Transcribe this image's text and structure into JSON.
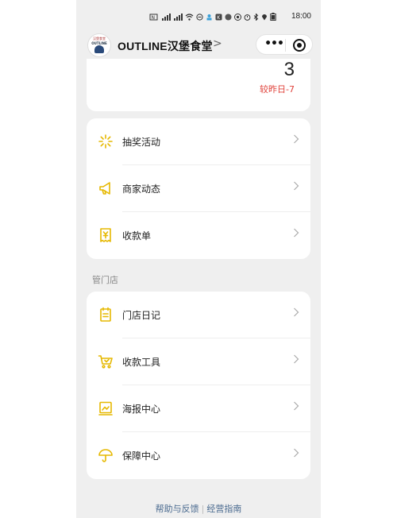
{
  "status_bar": {
    "time": "18:00",
    "left_icons": [
      "nfc-icon",
      "signal-icon",
      "signal-icon",
      "wifi-icon",
      "do-not-disturb-icon"
    ],
    "right_icons": [
      "app-icon",
      "app-icon",
      "app-icon",
      "app-icon",
      "alarm-icon",
      "bluetooth-icon",
      "location-icon",
      "battery-icon"
    ]
  },
  "header": {
    "logo_top_text": "汉堡食堂",
    "logo_mid_text": "OUTLINE",
    "title": "OUTLINE汉堡食堂",
    "chevron": ">"
  },
  "capsule": {
    "more": "•••"
  },
  "stat": {
    "value": "3",
    "compare": "较昨日-7"
  },
  "menu_group_1": [
    {
      "label": "抽奖活动",
      "icon": "lottery-icon"
    },
    {
      "label": "商家动态",
      "icon": "megaphone-icon"
    },
    {
      "label": "收款单",
      "icon": "receipt-icon"
    }
  ],
  "section_title": "管门店",
  "menu_group_2": [
    {
      "label": "门店日记",
      "icon": "diary-icon"
    },
    {
      "label": "收款工具",
      "icon": "cart-icon"
    },
    {
      "label": "海报中心",
      "icon": "poster-icon"
    },
    {
      "label": "保障中心",
      "icon": "umbrella-icon"
    }
  ],
  "footer": {
    "help": "帮助与反馈",
    "separator": "|",
    "guide": "经营指南"
  },
  "colors": {
    "accent_icon": "#e6b800",
    "negative": "#e0413a",
    "link": "#4a6a8f"
  }
}
